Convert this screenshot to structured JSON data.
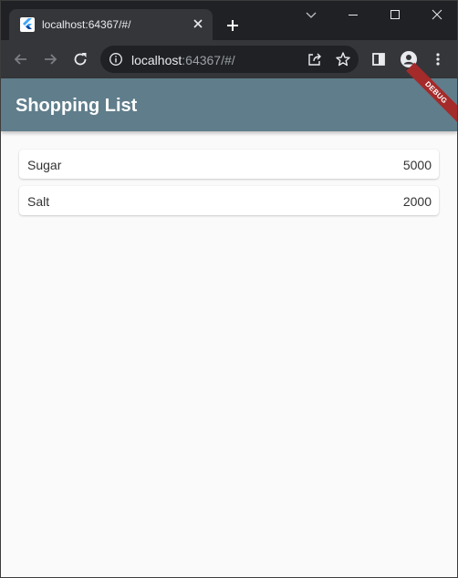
{
  "browser": {
    "tab_title": "localhost:64367/#/",
    "url_host": "localhost",
    "url_rest": ":64367/#/"
  },
  "app": {
    "title": "Shopping List",
    "debug_label": "DEBUG",
    "theme_color": "#607d8b",
    "items": [
      {
        "name": "Sugar",
        "quantity": "5000"
      },
      {
        "name": "Salt",
        "quantity": "2000"
      }
    ]
  }
}
